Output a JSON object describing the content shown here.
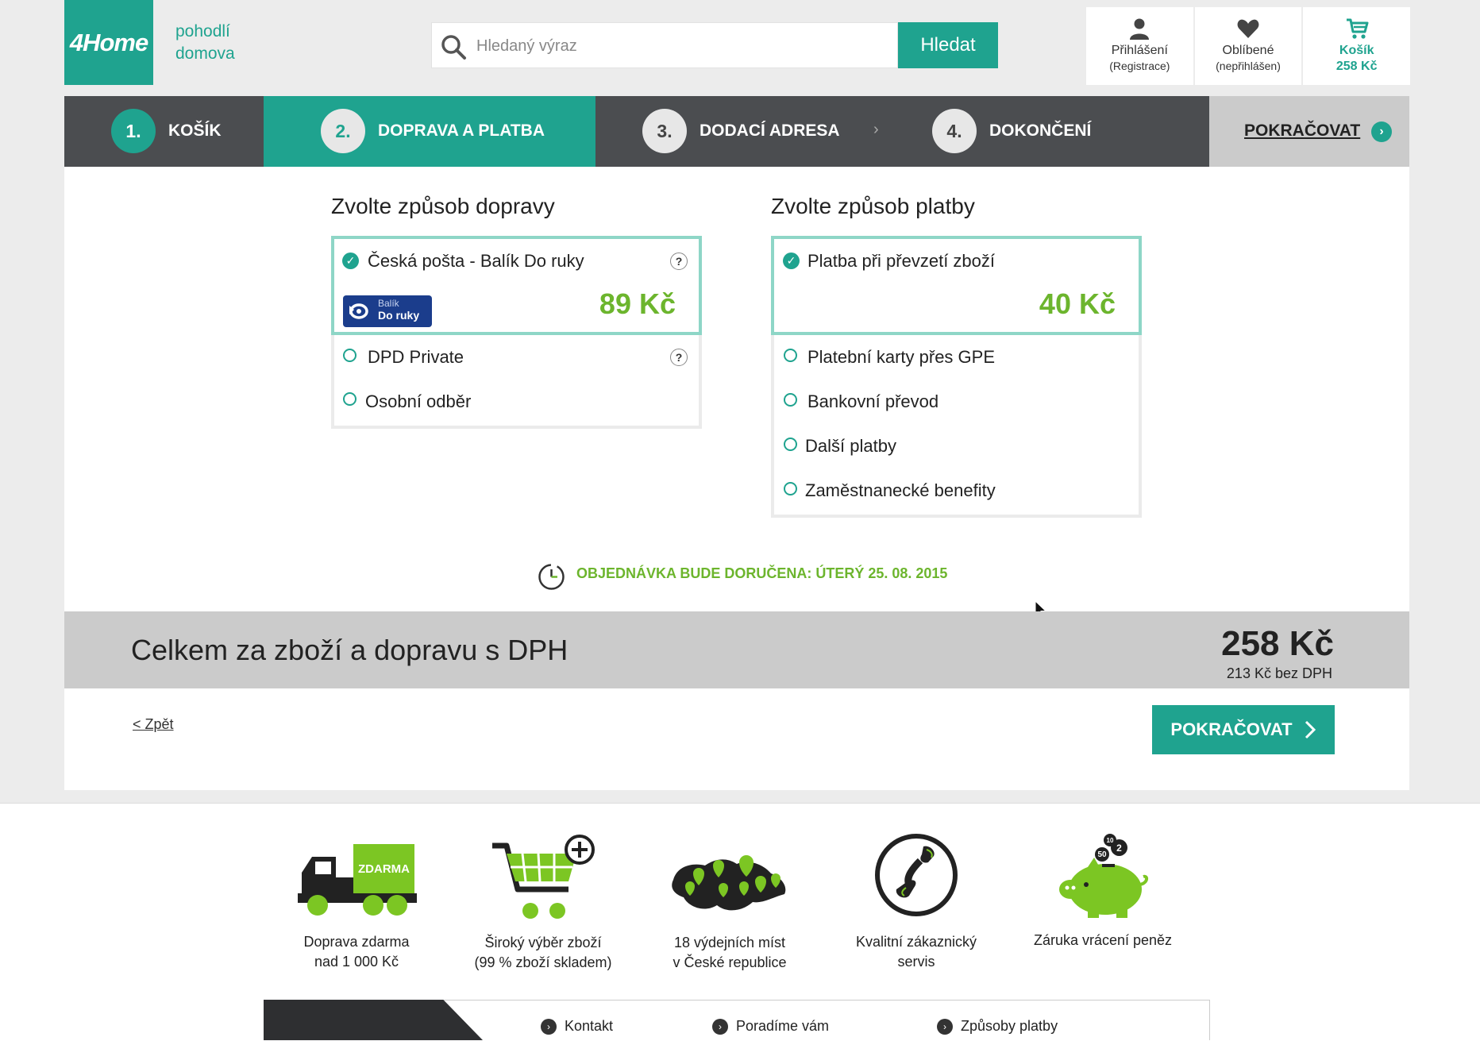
{
  "header": {
    "logo_text": "4Home",
    "tagline_line1": "pohodlí",
    "tagline_line2": "domova",
    "search": {
      "placeholder": "Hledaný výraz",
      "button_label": "Hledat"
    },
    "account": {
      "login_label": "Přihlášení",
      "login_sub": "(Registrace)",
      "favorites_label": "Oblíbené",
      "favorites_sub": "(nepřihlášen)",
      "cart_label": "Košík",
      "cart_total": "258 Kč"
    }
  },
  "steps": [
    {
      "number": "1.",
      "label": "KOŠÍK"
    },
    {
      "number": "2.",
      "label": "DOPRAVA A PLATBA"
    },
    {
      "number": "3.",
      "label": "DODACÍ ADRESA"
    },
    {
      "number": "4.",
      "label": "DOKONČENÍ"
    }
  ],
  "steps_continue_label": "POKRAČOVAT",
  "shipping": {
    "title": "Zvolte způsob dopravy",
    "selected": {
      "label": "Česká pošta - Balík Do ruky",
      "price": "89 Kč",
      "badge_line1": "Balík",
      "badge_line2": "Do ruky"
    },
    "options": [
      "DPD Private",
      "Osobní odběr"
    ]
  },
  "payment": {
    "title": "Zvolte způsob platby",
    "selected": {
      "label": "Platba při převzetí zboží",
      "price": "40 Kč"
    },
    "options": [
      "Platební karty přes GPE",
      "Bankovní převod",
      "Další platby",
      "Zaměstnanecké benefity"
    ]
  },
  "delivery_note": "OBJEDNÁVKA BUDE DORUČENA: ÚTERÝ 25. 08. 2015",
  "total": {
    "label": "Celkem za zboží a dopravu s DPH",
    "price": "258 Kč",
    "without_vat": "213 Kč bez DPH"
  },
  "back_link": "< Zpět",
  "continue_label": "POKRAČOVAT",
  "footer": {
    "truck_badge": "ZDARMA",
    "features": [
      {
        "line1": "Doprava zdarma",
        "line2": "nad 1 000 Kč",
        "icon": "truck-icon"
      },
      {
        "line1": "Široký výběr zboží",
        "line2": "(99 % zboží skladem)",
        "icon": "cart-plus-icon"
      },
      {
        "line1": "18 výdejních míst",
        "line2": "v České republice",
        "icon": "map-icon"
      },
      {
        "line1": "Kvalitní zákaznický",
        "line2": "servis",
        "icon": "phone-icon"
      },
      {
        "line1": "Záruka vrácení peněz",
        "line2": "",
        "icon": "piggy-bank-icon"
      }
    ],
    "coins": [
      "10",
      "2",
      "50"
    ],
    "nav": [
      "Kontakt",
      "Poradíme vám",
      "Způsoby platby"
    ]
  },
  "colors": {
    "accent": "#1fa38f",
    "price_green": "#6cb52d",
    "dark_bar": "#4b4d50"
  }
}
